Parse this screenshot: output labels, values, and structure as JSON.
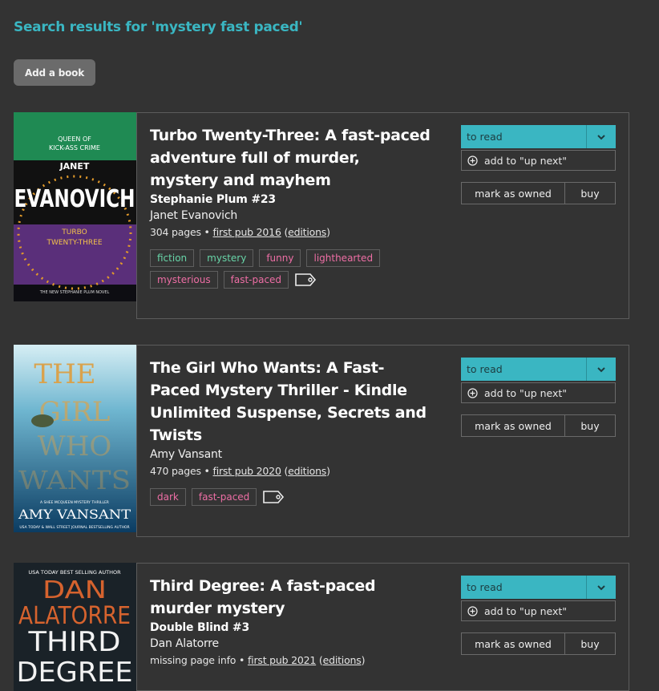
{
  "page": {
    "title": "Search results for 'mystery fast paced'"
  },
  "toolbar": {
    "add_book_label": "Add a book"
  },
  "results": [
    {
      "title": "Turbo Twenty-Three: A fast-paced adventure full of murder, mystery and mayhem",
      "series": "Stephanie Plum #23",
      "author": "Janet Evanovich",
      "pages": "304 pages",
      "separator": "•",
      "first_pub": "first pub 2016",
      "editions": "editions",
      "tags": [
        {
          "label": "fiction",
          "color": "#68d5a8"
        },
        {
          "label": "mystery",
          "color": "#68d5a8"
        },
        {
          "label": "funny",
          "color": "#ee6ea5"
        },
        {
          "label": "lighthearted",
          "color": "#ee6ea5"
        },
        {
          "label": "mysterious",
          "color": "#ee6ea5"
        },
        {
          "label": "fast-paced",
          "color": "#ee6ea5"
        }
      ],
      "cover": {
        "top": "QUEEN OF",
        "top2": "KICK-ASS CRIME",
        "author_first": "JANET",
        "author_last": "EVANOVICH",
        "title1": "TURBO",
        "title2": "TWENTY-THREE",
        "footer": "THE NEW STEPHANIE PLUM NOVEL"
      },
      "status": "to read",
      "up_next": "add to \"up next\"",
      "mark_owned": "mark as owned",
      "buy": "buy"
    },
    {
      "title": "The Girl Who Wants: A Fast-Paced Mystery Thriller - Kindle Unlimited Suspense, Secrets and Twists",
      "author": "Amy Vansant",
      "pages": "470 pages",
      "separator": "•",
      "first_pub": "first pub 2020",
      "editions": "editions",
      "tags": [
        {
          "label": "dark",
          "color": "#ee6ea5"
        },
        {
          "label": "fast-paced",
          "color": "#ee6ea5"
        }
      ],
      "cover": {
        "line1": "THE",
        "line2": "GIRL",
        "line3": "WHO",
        "line4": "WANTS",
        "small": "A SHEE MCQUEEN MYSTERY THRILLER",
        "author": "AMY VANSANT",
        "footer": "USA TODAY & WALL STREET JOURNAL BESTSELLING AUTHOR"
      },
      "status": "to read",
      "up_next": "add to \"up next\"",
      "mark_owned": "mark as owned",
      "buy": "buy"
    },
    {
      "title": "Third Degree: A fast-paced murder mystery",
      "series": "Double Blind #3",
      "author": "Dan Alatorre",
      "pages": "missing page info",
      "separator": "•",
      "first_pub": "first pub 2021",
      "editions": "editions",
      "cover": {
        "top": "USA TODAY BEST SELLING AUTHOR",
        "author1": "DAN",
        "author2": "ALATORRE",
        "title1": "THIRD",
        "title2": "DEGREE"
      },
      "status": "to read",
      "up_next": "add to \"up next\"",
      "mark_owned": "mark as owned",
      "buy": "buy"
    }
  ],
  "icons": {
    "caret": "chevron-down-icon",
    "plus": "plus-circle-icon",
    "tag": "tag-icon"
  }
}
